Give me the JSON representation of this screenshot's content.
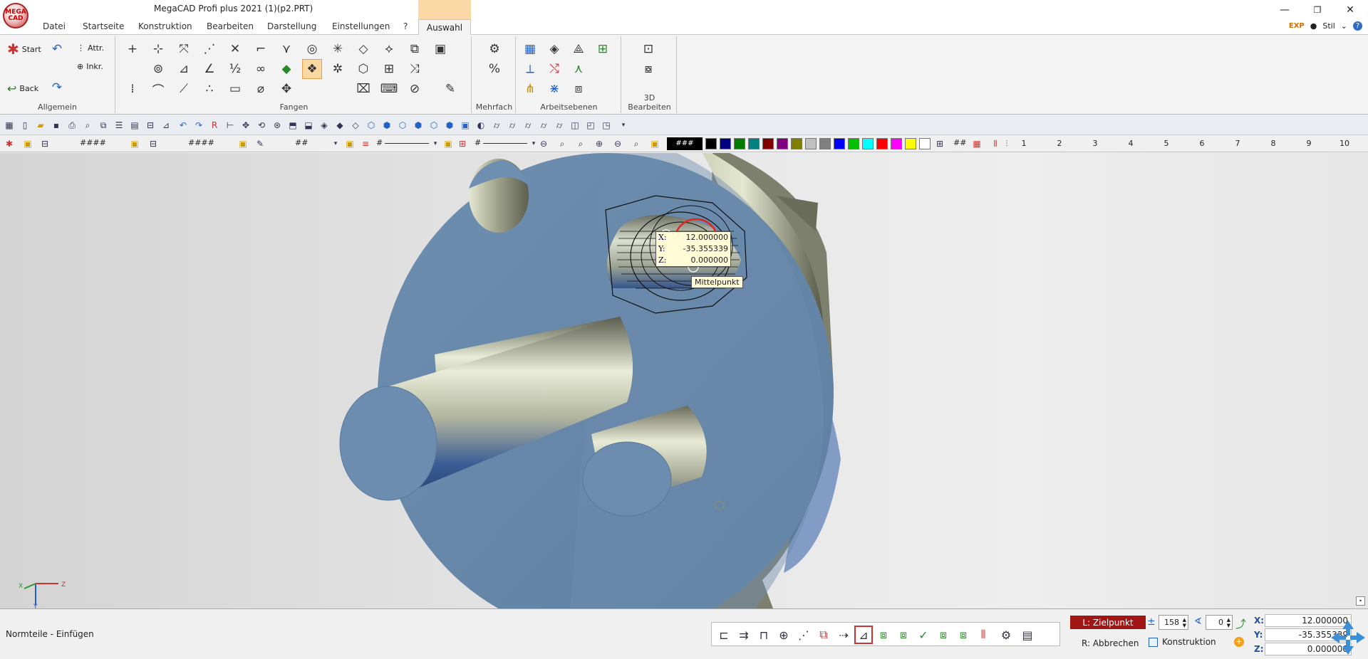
{
  "app": {
    "title": "MegaCAD Profi plus 2021 (1)(p2.PRT)",
    "logo_text": "MEGA CAD",
    "context_tab_header": "",
    "window_controls": {
      "minimize": "—",
      "restore": "❐",
      "close": "✕"
    }
  },
  "menu": {
    "items": [
      "Datei",
      "Startseite",
      "Konstruktion",
      "Bearbeiten",
      "Darstellung",
      "Einstellungen",
      "?",
      "Auswahl"
    ],
    "active": "Auswahl",
    "right": {
      "badge": "EXP",
      "style_label": "Stil",
      "help": "?"
    }
  },
  "ribbon": {
    "groups": [
      "Allgemein",
      "Fangen",
      "Mehrfach",
      "Arbeitsebenen",
      "3D Bearbeiten"
    ],
    "allgemein": {
      "start": "Start",
      "back": "Back",
      "attr": "Attr.",
      "inkr": "Inkr."
    }
  },
  "toolbar2": {
    "fields": [
      "####",
      "####",
      "##",
      "#",
      "#"
    ],
    "color_field": "###",
    "grid_field": "##",
    "layer_numbers": [
      "1",
      "2",
      "3",
      "4",
      "5",
      "6",
      "7",
      "8",
      "9",
      "10"
    ],
    "colors": [
      "#000000",
      "#000080",
      "#007a00",
      "#008080",
      "#800000",
      "#800080",
      "#808000",
      "#c0c0c0",
      "#808080",
      "#0000ff",
      "#00c000",
      "#00ffff",
      "#ff0000",
      "#ff00ff",
      "#ffff00",
      "#ffffff"
    ]
  },
  "viewport": {
    "tooltip": {
      "x_label": "X:",
      "x": "12.000000",
      "y_label": "Y:",
      "y": "-35.355339",
      "z_label": "Z:",
      "z": "0.000000"
    },
    "snap_hint": "Mittelpunkt",
    "triad": {
      "x": "X",
      "y": "Y",
      "z": "Z"
    }
  },
  "statusbar": {
    "message": "Normteile - Einfügen",
    "target_label": "L: Zielpunkt",
    "step_value": "158",
    "angle_value": "0",
    "abort_label": "R: Abbrechen",
    "construction_label": "Konstruktion",
    "coords": {
      "x_label": "X:",
      "x": "12.000000",
      "y_label": "Y:",
      "y": "-35.355339",
      "z_label": "Z:",
      "z": "0.000000"
    }
  }
}
